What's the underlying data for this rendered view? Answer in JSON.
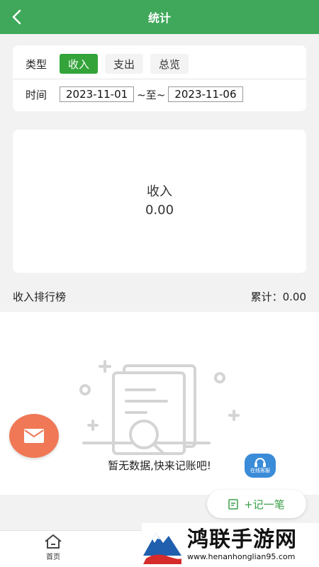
{
  "header": {
    "title": "统计"
  },
  "filter": {
    "type_label": "类型",
    "tabs": [
      {
        "label": "收入",
        "active": true
      },
      {
        "label": "支出",
        "active": false
      },
      {
        "label": "总览",
        "active": false
      }
    ],
    "time_label": "时间",
    "start_date": "2023-11-01",
    "range_separator": "~至~",
    "end_date": "2023-11-06"
  },
  "summary": {
    "title": "收入",
    "value": "0.00"
  },
  "ranking": {
    "title": "收入排行榜",
    "total": "累计：0.00"
  },
  "empty": {
    "message": "暂无数据,快来记账吧!"
  },
  "customer_service": {
    "label": "在线客服"
  },
  "add_button": {
    "label": "+记一笔",
    "icon": "note-edit-icon"
  },
  "tabbar": {
    "home_label": "首页"
  },
  "watermark": {
    "title": "鸿联手游网",
    "url": "www.henanhonglian95.com"
  },
  "colors": {
    "header": "#3fa85a",
    "active_tab": "#33a33a",
    "mail_button": "#f07856",
    "cs_button": "#3a8cd8",
    "add_text": "#3aa04a"
  }
}
